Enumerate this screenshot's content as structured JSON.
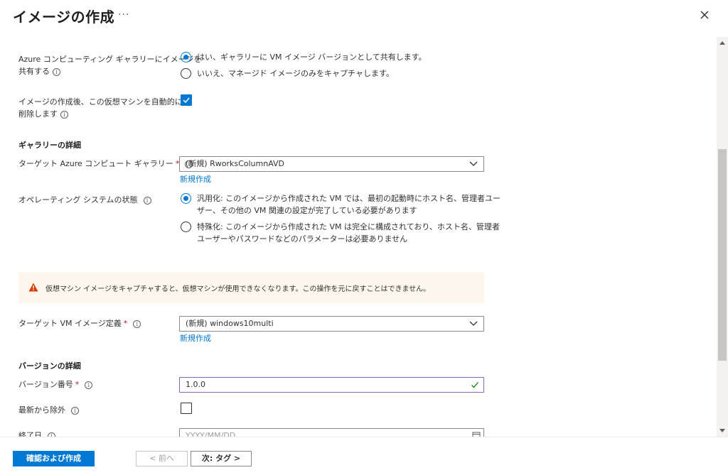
{
  "header": {
    "title": "イメージの作成",
    "more": "···"
  },
  "share": {
    "label_line1": "Azure コンピューティング ギャラリーにイメージを",
    "label_line2": "共有する",
    "option_yes": "はい、ギャラリーに VM イメージ バージョンとして共有します。",
    "option_no": "いいえ、マネージド イメージのみをキャプチャします。"
  },
  "auto_delete": {
    "label_line1": "イメージの作成後、この仮想マシンを自動的に",
    "label_line2": "削除します",
    "checked": true
  },
  "gallery_details": {
    "section_title": "ギャラリーの詳細",
    "target_gallery_label": "ターゲット Azure コンピュート ギャラリー",
    "target_gallery_value": "(新規) RworksColumnAVD",
    "create_new": "新規作成",
    "os_state_label": "オペレーティング システムの状態",
    "generalized_line1": "汎用化: このイメージから作成された VM では、最初の起動時にホスト名、管理者ユー",
    "generalized_line2": "ザー、その他の VM 関連の設定が完了している必要があります",
    "specialized_line1": "特殊化: このイメージから作成された VM は完全に構成されており、ホスト名、管理者",
    "specialized_line2": "ユーザーやパスワードなどのパラメーターは必要ありません"
  },
  "warning": {
    "text": "仮想マシン イメージをキャプチャすると、仮想マシンが使用できなくなります。この操作を元に戻すことはできません。"
  },
  "image_definition": {
    "label": "ターゲット VM イメージ定義",
    "value": "(新規) windows10multi",
    "create_new": "新規作成"
  },
  "version_details": {
    "section_title": "バージョンの詳細",
    "version_label": "バージョン番号",
    "version_value": "1.0.0",
    "exclude_label": "最新から除外",
    "end_date_label": "終了日",
    "end_date_placeholder": "YYYY/MM/DD"
  },
  "footer": {
    "review_create": "確認および作成",
    "previous": "< 前へ",
    "next": "次: タグ >"
  },
  "colors": {
    "accent": "#0078d4",
    "required": "#a4262c",
    "warning_icon": "#d83b01"
  }
}
